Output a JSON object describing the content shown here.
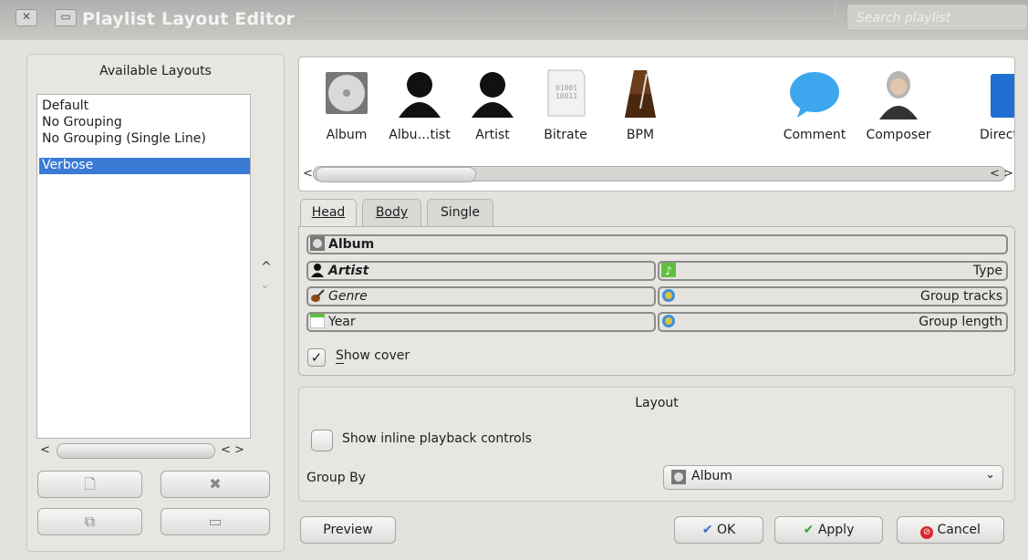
{
  "window": {
    "title": "Playlist Layout Editor",
    "search_placeholder": "Search playlist"
  },
  "left": {
    "header": "Available Layouts",
    "layouts": [
      "Default",
      "No Grouping",
      "No Grouping (Single Line)",
      "Verbose"
    ],
    "selected_index": 3
  },
  "elements": [
    {
      "label": "Album",
      "icon": "album-disc-icon"
    },
    {
      "label": "Albu…tist",
      "icon": "album-artist-icon"
    },
    {
      "label": "Artist",
      "icon": "artist-icon"
    },
    {
      "label": "Bitrate",
      "icon": "bitrate-icon"
    },
    {
      "label": "BPM",
      "icon": "metronome-icon"
    },
    {
      "label": "Comment",
      "icon": "comment-bubble-icon"
    },
    {
      "label": "Composer",
      "icon": "composer-icon"
    },
    {
      "label": "Direct",
      "icon": "folder-icon"
    }
  ],
  "tabs": {
    "head": "Head",
    "body": "Body",
    "single": "Single",
    "active": "Head"
  },
  "head_rows": {
    "album": "Album",
    "artist": "Artist",
    "type": "Type",
    "genre": "Genre",
    "group_tracks": "Group tracks",
    "year": "Year",
    "group_length": "Group length"
  },
  "show_cover": {
    "label": "Show cover",
    "checked": true
  },
  "layout_section": {
    "title": "Layout",
    "inline_controls": {
      "label": "Show inline playback controls",
      "checked": false
    },
    "group_by_label": "Group By",
    "group_by_value": "Album"
  },
  "buttons": {
    "preview": "Preview",
    "ok": "OK",
    "apply": "Apply",
    "cancel": "Cancel"
  },
  "colors": {
    "selection": "#3a7bd5",
    "ok_check": "#3a6fd0",
    "apply_check": "#3aa23a",
    "cancel": "#d8262d"
  }
}
